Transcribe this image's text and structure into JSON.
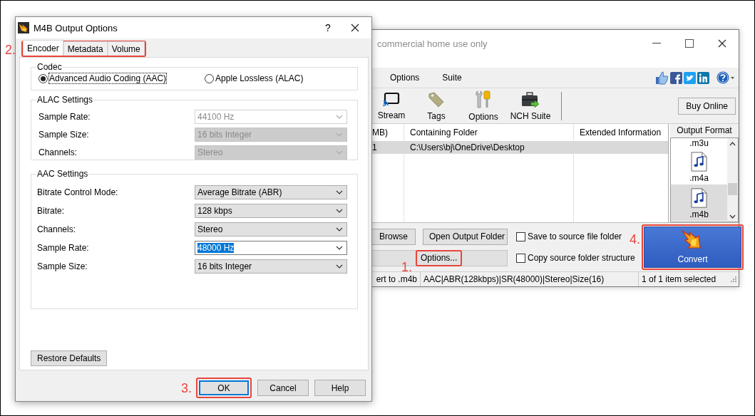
{
  "main_window": {
    "title": "commercial home use only",
    "menu": [
      {
        "label": "Options"
      },
      {
        "label": "Suite"
      }
    ],
    "toolbar": [
      {
        "label": "Stream",
        "kind": "stream"
      },
      {
        "label": "Tags",
        "kind": "tags"
      },
      {
        "label": "Options",
        "kind": "tools"
      },
      {
        "label": "NCH Suite",
        "kind": "suite"
      }
    ],
    "buy_button": "Buy Online",
    "table": {
      "columns": [
        "MB)",
        "Containing Folder",
        "Extended Information"
      ],
      "rows": [
        {
          "cells": [
            "1",
            "C:\\Users\\bj\\OneDrive\\Desktop"
          ],
          "selected": true
        }
      ]
    },
    "output_format": {
      "title": "Output Format",
      "items": [
        {
          "label": ".m3u",
          "kind": "cut",
          "selected": false
        },
        {
          "label": ".m4a",
          "kind": "file",
          "selected": false
        },
        {
          "label": ".m4b",
          "kind": "file",
          "selected": true
        }
      ]
    },
    "buttons": [
      {
        "label": "Browse"
      },
      {
        "label": "Open Output Folder"
      }
    ],
    "options_button": {
      "label": "Options...",
      "step": "1."
    },
    "checkboxes": [
      {
        "label": "Save to source file folder",
        "checked": false
      },
      {
        "label": "Copy source folder structure",
        "checked": false
      }
    ],
    "convert_button": {
      "label": "Convert",
      "step": "4."
    },
    "status_bar": [
      "ert to .m4b",
      "AAC|ABR(128kbps)|SR(48000)|Stereo|Size(16)",
      "1 of 1 item selected"
    ]
  },
  "dialog": {
    "title": "M4B Output Options",
    "help": "?",
    "tabs_step": "2.",
    "tabs": [
      {
        "label": "Encoder",
        "selected": true
      },
      {
        "label": "Metadata",
        "selected": false
      },
      {
        "label": "Volume",
        "selected": false
      }
    ],
    "groups": [
      {
        "title": "Codec",
        "kind": "radios",
        "options": [
          {
            "label": "Advanced Audio Coding (AAC)",
            "selected": true
          },
          {
            "label": "Apple Lossless (ALAC)",
            "selected": false
          }
        ]
      },
      {
        "title": "ALAC Settings",
        "kind": "fields",
        "fields": [
          {
            "label": "Sample Rate:",
            "value": "44100 Hz",
            "disabled": true,
            "editable": true,
            "highlighted": false
          },
          {
            "label": "Sample Size:",
            "value": "16 bits Integer",
            "disabled": true,
            "editable": false,
            "highlighted": false
          },
          {
            "label": "Channels:",
            "value": "Stereo",
            "disabled": true,
            "editable": false,
            "highlighted": false
          }
        ]
      },
      {
        "title": "AAC Settings",
        "kind": "fields",
        "fields": [
          {
            "label": "Bitrate Control Mode:",
            "value": "Average Bitrate (ABR)",
            "disabled": false,
            "editable": false,
            "highlighted": false
          },
          {
            "label": "Bitrate:",
            "value": "128 kbps",
            "disabled": false,
            "editable": false,
            "highlighted": false
          },
          {
            "label": "Channels:",
            "value": "Stereo",
            "disabled": false,
            "editable": false,
            "highlighted": false
          },
          {
            "label": "Sample Rate:",
            "value": "48000 Hz",
            "disabled": false,
            "editable": true,
            "highlighted": true
          },
          {
            "label": "Sample Size:",
            "value": "16 bits Integer",
            "disabled": false,
            "editable": false,
            "highlighted": false
          }
        ]
      }
    ],
    "restore_button": "Restore Defaults",
    "buttons": [
      {
        "label": "OK",
        "step": "3.",
        "focused": true
      },
      {
        "label": "Cancel",
        "focused": false
      },
      {
        "label": "Help",
        "focused": false
      }
    ]
  }
}
